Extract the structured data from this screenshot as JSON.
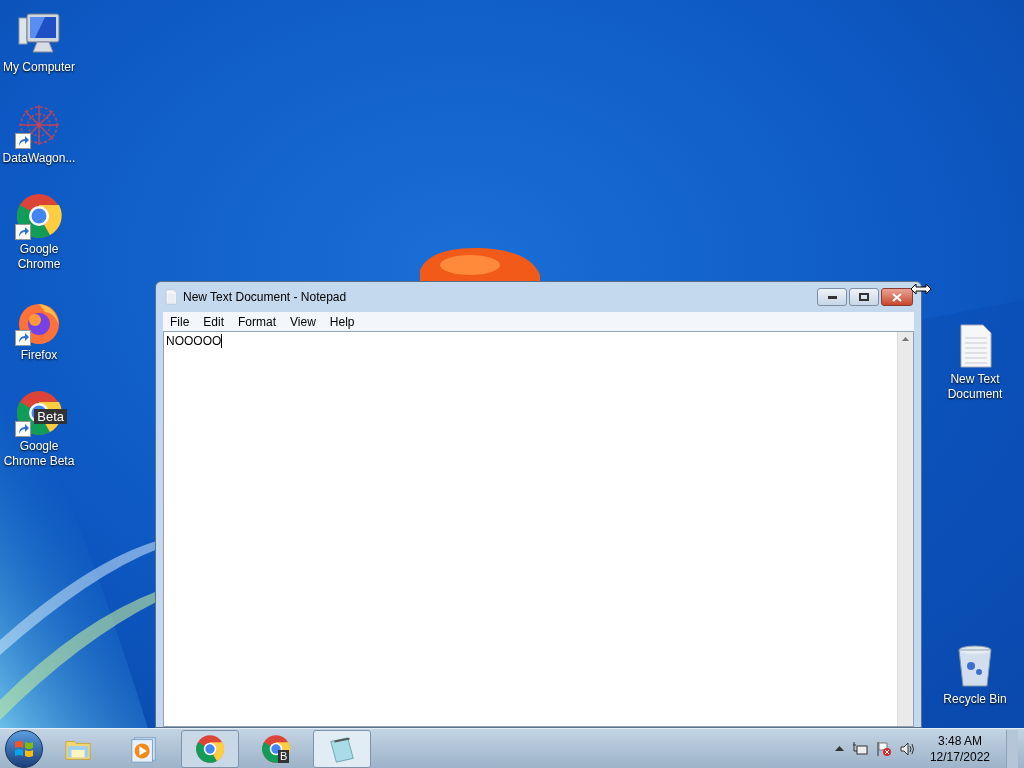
{
  "desktop_icons_left": [
    {
      "label": "My Computer",
      "kind": "computer",
      "shortcut": false
    },
    {
      "label": "DataWagon...",
      "kind": "datawagon",
      "shortcut": true
    },
    {
      "label": "Google Chrome",
      "kind": "chrome",
      "shortcut": true
    },
    {
      "label": "Firefox",
      "kind": "firefox",
      "shortcut": true
    },
    {
      "label": "Google Chrome Beta",
      "kind": "chrome",
      "shortcut": true,
      "badge": "Beta"
    }
  ],
  "desktop_icons_right": [
    {
      "label": "New Text Document",
      "kind": "textfile",
      "shortcut": false
    },
    {
      "label": "Recycle Bin",
      "kind": "recycle",
      "shortcut": false
    }
  ],
  "window": {
    "title": "New Text Document - Notepad",
    "menu": [
      "File",
      "Edit",
      "Format",
      "View",
      "Help"
    ],
    "content": "NOOOOO"
  },
  "taskbar": {
    "buttons": [
      {
        "kind": "explorer",
        "running": false,
        "selected": false
      },
      {
        "kind": "media",
        "running": false,
        "selected": false
      },
      {
        "kind": "chrome",
        "running": true,
        "selected": false
      },
      {
        "kind": "chrome",
        "running": false,
        "selected": false,
        "badge": "B"
      },
      {
        "kind": "notepad",
        "running": true,
        "selected": true
      }
    ],
    "time": "3:48 AM",
    "date": "12/17/2022"
  }
}
